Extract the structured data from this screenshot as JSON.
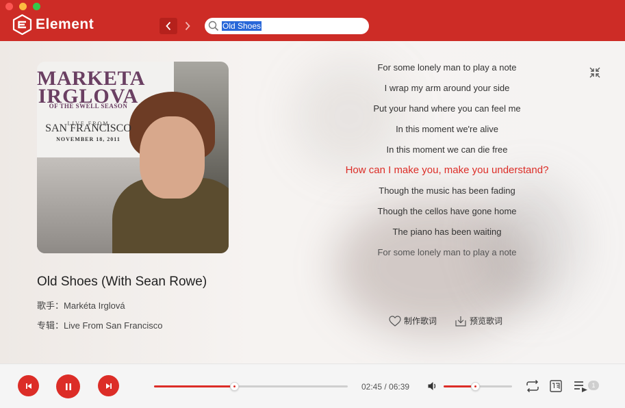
{
  "app": {
    "name": "Element",
    "brand_color": "#cd2c26",
    "accent_color": "#dc2d27"
  },
  "search": {
    "value": "Old Shoes"
  },
  "song": {
    "title": "Old Shoes (With Sean Rowe)",
    "artist_label": "歌手：",
    "artist": "Markéta Irglová",
    "album_label": "专辑：",
    "album": "Live From San Francisco"
  },
  "cover": {
    "line1": "MARKETA",
    "line2": "IRGLOVA",
    "line3": "OF THE SWELL SEASON",
    "line4": "LIVE FROM",
    "line5": "SAN FRANCISCO",
    "line6": "NOVEMBER 18, 2011"
  },
  "lyrics": {
    "lines": [
      "For some lonely man to play a note",
      "I wrap my arm around your side",
      "Put your hand where you can feel me",
      "In this moment we're alive",
      "In this moment we can die free",
      "How can I make you, make you understand?",
      "Though the music has been fading",
      "Though the cellos have gone home",
      "The piano has been waiting",
      "For some lonely man to play a note"
    ],
    "current_index": 5
  },
  "actions": {
    "make_lyrics": "制作歌词",
    "preview_lyrics": "预览歌词"
  },
  "player": {
    "current_time": "02:45",
    "duration": "06:39",
    "time_separator": " / ",
    "progress": 0.414,
    "volume": 0.46,
    "playlist_count": "1"
  },
  "icons": {
    "back": "chevron-left-icon",
    "forward": "chevron-right-icon",
    "search": "search-icon",
    "minimize": "collapse-icon",
    "favorite": "heart-icon",
    "download": "download-icon",
    "prev": "skip-previous-icon",
    "pause": "pause-icon",
    "next": "skip-next-icon",
    "volume": "volume-icon",
    "repeat": "repeat-icon",
    "lyrics": "lyrics-icon",
    "playlist": "playlist-icon"
  }
}
